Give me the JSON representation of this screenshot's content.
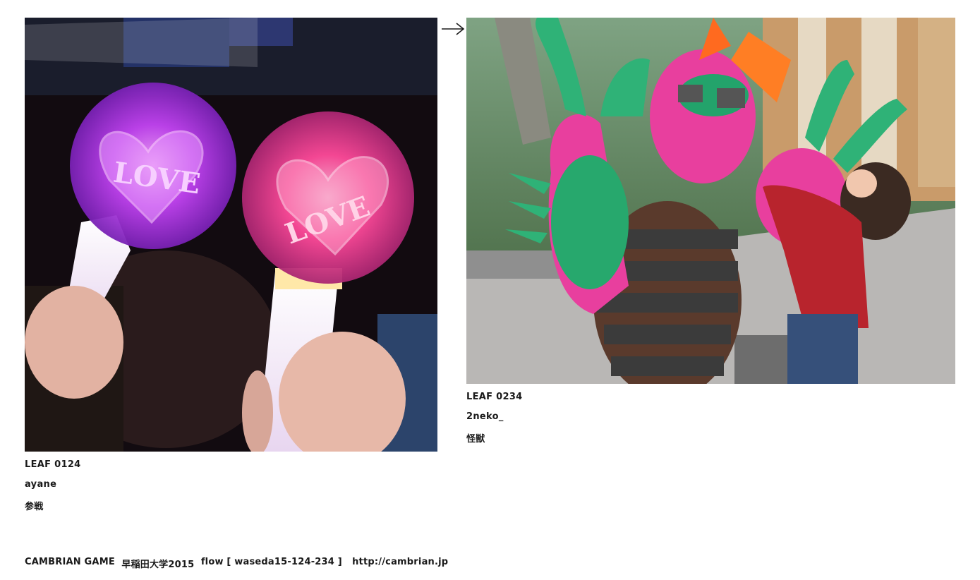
{
  "leaves": [
    {
      "id": "LEAF 0124",
      "user": "ayane",
      "word": "参戦"
    },
    {
      "id": "LEAF 0234",
      "user": "2neko_",
      "word": "怪獣"
    }
  ],
  "photo_text": {
    "glowstick_word": "LOVE"
  },
  "navigation": {
    "arrow_icon": "right-arrow-icon"
  },
  "footer": {
    "project": "CAMBRIAN GAME",
    "event": "早稲田大学2015",
    "flow_label": "flow [ waseda15-124-234 ]",
    "url": "http://cambrian.jp"
  }
}
